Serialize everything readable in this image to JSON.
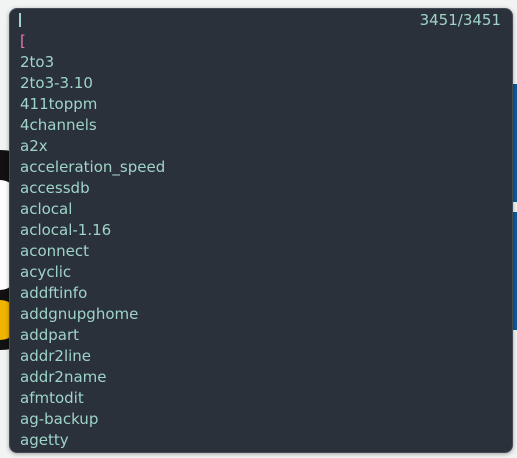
{
  "launcher": {
    "input_value": "",
    "counter": "3451/3451",
    "items": [
      "[",
      "2to3",
      "2to3-3.10",
      "411toppm",
      "4channels",
      "a2x",
      "acceleration_speed",
      "accessdb",
      "aclocal",
      "aclocal-1.16",
      "aconnect",
      "acyclic",
      "addftinfo",
      "addgnupghome",
      "addpart",
      "addr2line",
      "addr2name",
      "afmtodit",
      "ag-backup",
      "agetty"
    ],
    "selected_index": 0
  },
  "colors": {
    "background": "#2b313a",
    "text": "#9fd4c8",
    "selected_text": "#e27ab0"
  }
}
